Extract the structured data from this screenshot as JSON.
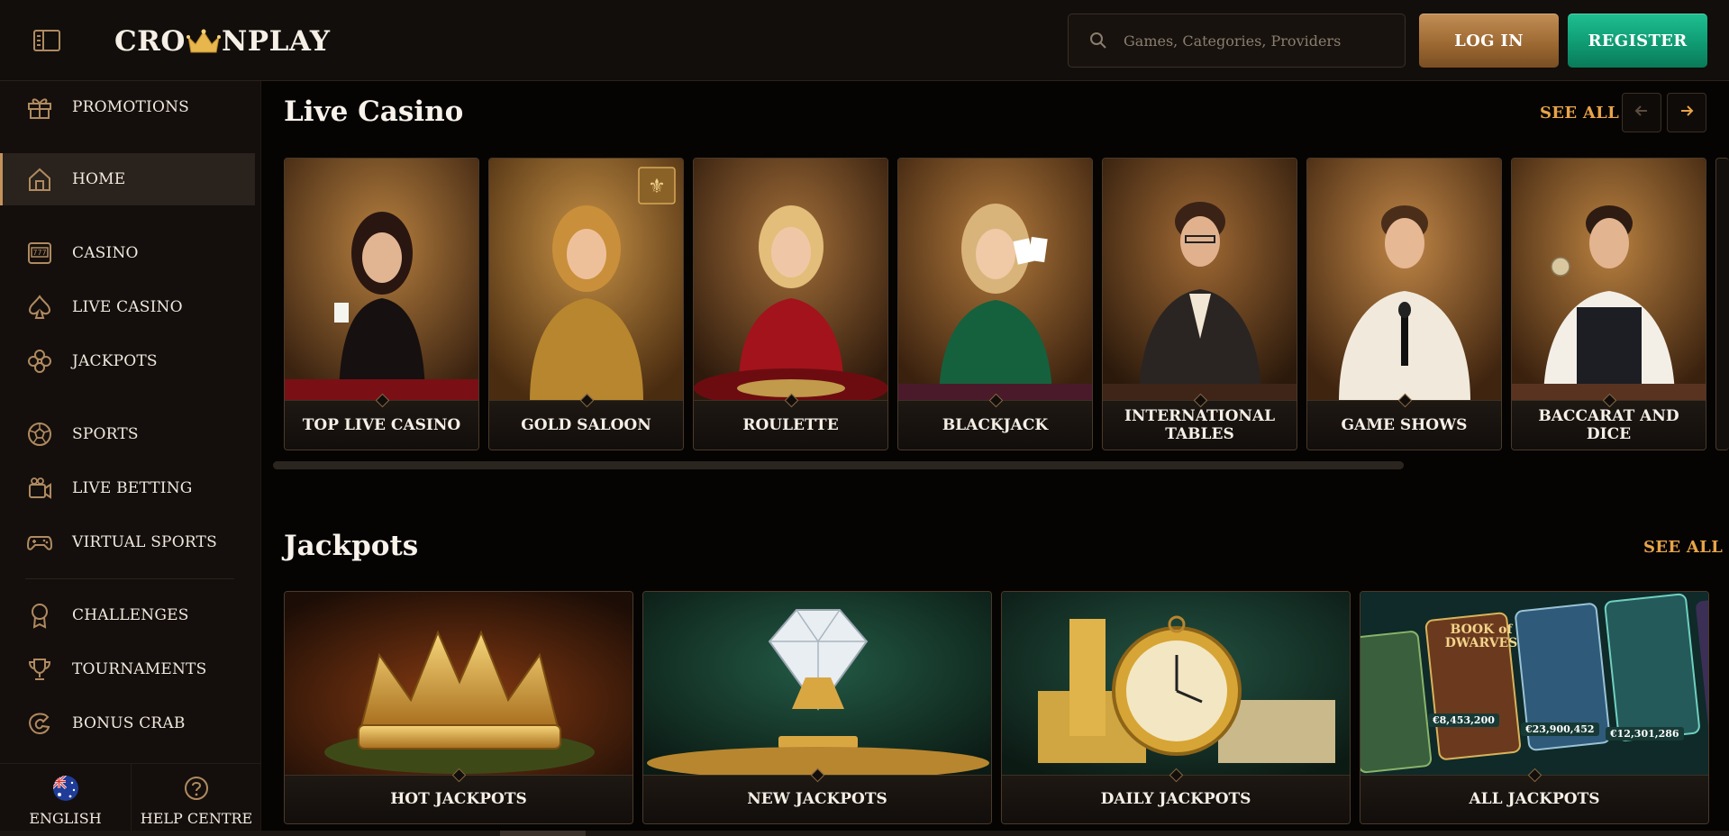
{
  "header": {
    "brand": "CROWNPLAY",
    "brand_left": "CRO",
    "brand_right": "NPLAY",
    "search_placeholder": "Games, Categories, Providers",
    "login_label": "LOG IN",
    "register_label": "REGISTER"
  },
  "sidebar": {
    "items": [
      {
        "label": "PROMOTIONS",
        "icon": "gift-icon"
      },
      {
        "label": "HOME",
        "icon": "home-icon",
        "active": true
      },
      {
        "label": "CASINO",
        "icon": "slot-machine-icon"
      },
      {
        "label": "LIVE CASINO",
        "icon": "spade-icon"
      },
      {
        "label": "JACKPOTS",
        "icon": "clover-icon"
      },
      {
        "label": "SPORTS",
        "icon": "soccer-ball-icon"
      },
      {
        "label": "LIVE BETTING",
        "icon": "camera-icon"
      },
      {
        "label": "VIRTUAL SPORTS",
        "icon": "gamepad-icon"
      },
      {
        "label": "CHALLENGES",
        "icon": "medal-icon"
      },
      {
        "label": "TOURNAMENTS",
        "icon": "trophy-icon"
      },
      {
        "label": "BONUS CRAB",
        "icon": "crab-claw-icon"
      }
    ],
    "language_label": "ENGLISH",
    "help_label": "HELP CENTRE"
  },
  "live_casino": {
    "title": "Live Casino",
    "see_all": "SEE ALL",
    "cards": [
      {
        "label": "TOP LIVE CASINO"
      },
      {
        "label": "GOLD SALOON"
      },
      {
        "label": "ROULETTE"
      },
      {
        "label": "BLACKJACK"
      },
      {
        "label": "INTERNATIONAL TABLES"
      },
      {
        "label": "GAME SHOWS"
      },
      {
        "label": "BACCARAT AND DICE"
      }
    ]
  },
  "jackpots": {
    "title": "Jackpots",
    "see_all": "SEE ALL",
    "cards": [
      {
        "label": "HOT JACKPOTS"
      },
      {
        "label": "NEW JACKPOTS"
      },
      {
        "label": "DAILY JACKPOTS"
      },
      {
        "label": "ALL JACKPOTS"
      }
    ],
    "all_jackpots_amounts": [
      "€8,453,200",
      "€23,900,452",
      "€12,301,286"
    ],
    "all_jackpots_game": "BOOK of DWARVES"
  },
  "colors": {
    "accent_gold": "#e8a448",
    "login_bronze": "#9e6a33",
    "register_green": "#0f9b73",
    "background": "#060403"
  }
}
